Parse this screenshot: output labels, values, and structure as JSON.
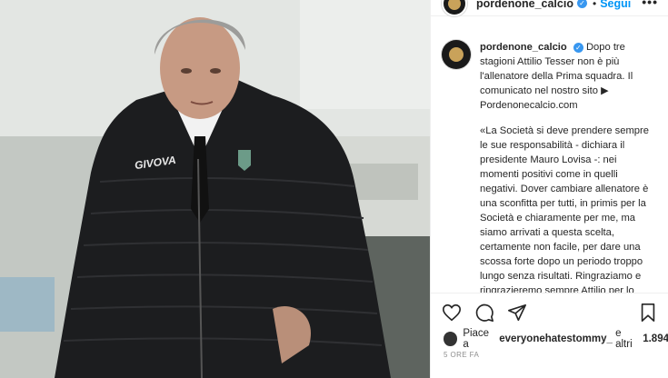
{
  "photo": {
    "jacket_brand": "GIVOVA"
  },
  "header": {
    "username": "pordenone_calcio",
    "separator": "•",
    "follow_label": "Segui",
    "more_label": "•••"
  },
  "caption": {
    "username": "pordenone_calcio",
    "intro": "Dopo tre stagioni Attilio Tesser non è più l'allenatore della Prima squadra. Il comunicato nel nostro sito ▶ Pordenonecalcio.com",
    "quote": "«La Società si deve prendere sempre le sue responsabilità - dichiara il presidente Mauro Lovisa -: nei momenti positivi come in quelli negativi. Dover cambiare allenatore è una sconfitta per tutti, in primis per la Società e chiaramente per me, ma siamo arrivati a questa scelta, certamente non facile, per dare una scossa forte dopo un periodo troppo lungo senza risultati. Ringraziamo e ringrazieremo sempre Attilio per lo spessore umano e la professionalità"
  },
  "likes": {
    "prefix": "Piace a",
    "user": "everyonehatestommy_",
    "middle": "e altri",
    "count": "1.894"
  },
  "timestamp": "5 ORE FA",
  "icons": [
    "heart-icon",
    "comment-icon",
    "share-icon",
    "bookmark-icon",
    "verified-icon"
  ],
  "colors": {
    "accent": "#0095f6",
    "verified": "#3897f0",
    "jacket": "#1c1d1f",
    "text": "#262626",
    "muted": "#8e8e8e"
  }
}
